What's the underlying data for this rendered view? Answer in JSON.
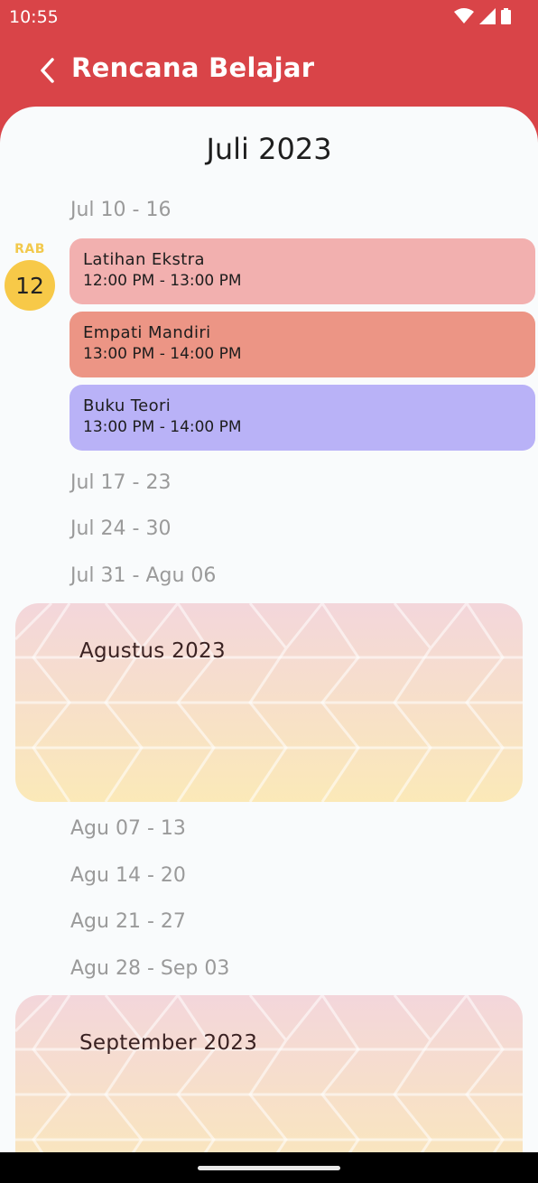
{
  "status_bar": {
    "time": "10:55"
  },
  "appbar": {
    "title": "Rencana Belajar",
    "back_icon": "chevron-left-icon"
  },
  "july": {
    "title": "Juli 2023",
    "weeks": [
      "Jul 10 - 16",
      "Jul 17 - 23",
      "Jul 24 - 30",
      "Jul 31 - Agu 06"
    ],
    "day": {
      "name": "RAB",
      "number": "12"
    },
    "events": [
      {
        "title": "Latihan Ekstra",
        "time": "12:00 PM - 13:00 PM",
        "color": "#f2b0af"
      },
      {
        "title": "Empati Mandiri",
        "time": "13:00 PM - 14:00 PM",
        "color": "#ec9585"
      },
      {
        "title": "Buku Teori",
        "time": "13:00 PM - 14:00 PM",
        "color": "#b9b2f7"
      }
    ]
  },
  "august": {
    "title": "Agustus 2023",
    "weeks": [
      "Agu 07 - 13",
      "Agu 14 - 20",
      "Agu 21 - 27",
      "Agu 28 - Sep 03"
    ]
  },
  "september": {
    "title": "September 2023"
  },
  "colors": {
    "primary": "#d94448",
    "today_badge": "#f7c948",
    "banner_top": "#f3d6db",
    "banner_bottom": "#fbe9b8"
  }
}
